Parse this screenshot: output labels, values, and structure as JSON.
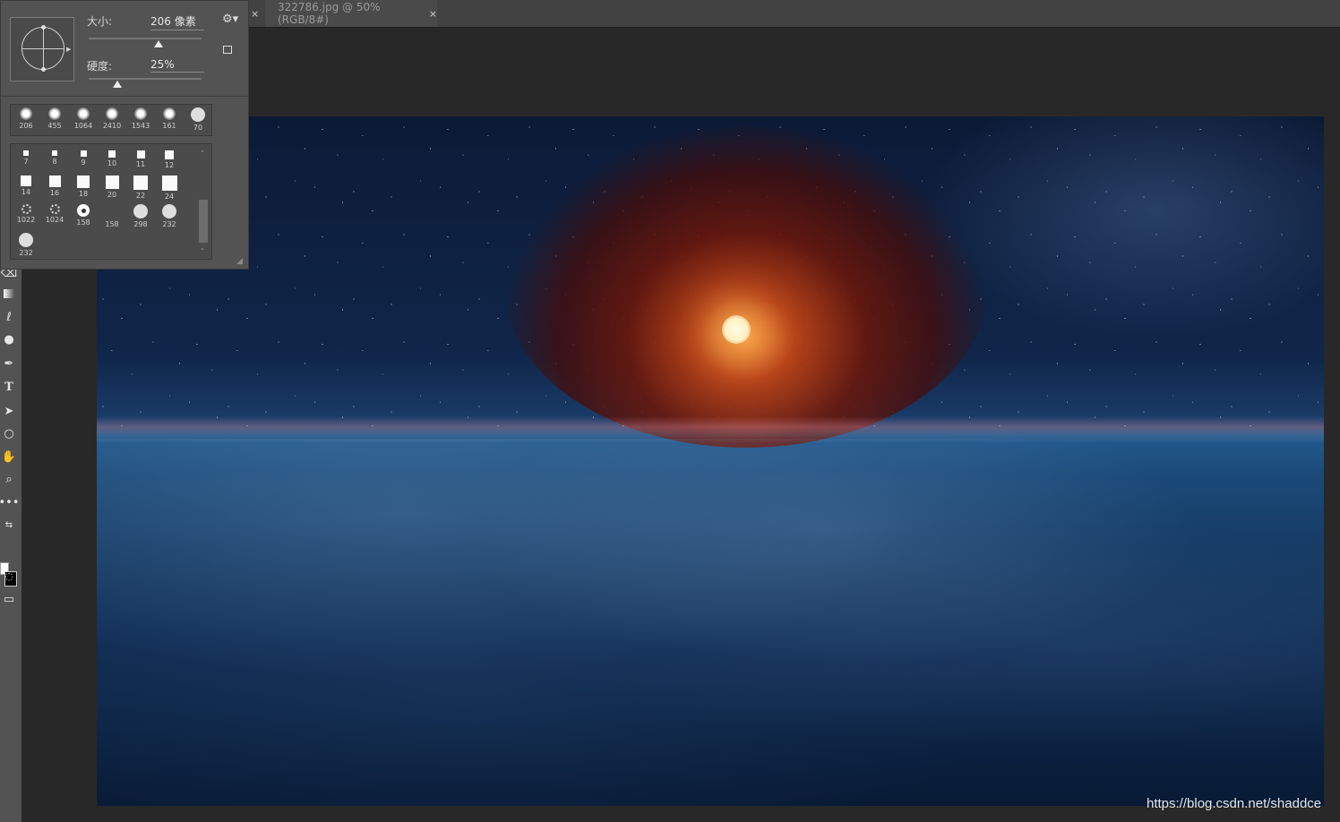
{
  "tabs": [
    {
      "label": "",
      "close": "×"
    },
    {
      "label": "322786.jpg @ 50%(RGB/8#)",
      "close": "×"
    }
  ],
  "brush_panel": {
    "size_label": "大小:",
    "size_value": "206 像素",
    "size_level": 0.62,
    "hardness_label": "硬度:",
    "hardness_value": "25%",
    "hardness_level": 0.25,
    "recent_brushes": [
      "206",
      "455",
      "1064",
      "2410",
      "1543",
      "161",
      "70"
    ],
    "brush_list": [
      [
        "7",
        "8",
        "9",
        "10",
        "11",
        "12"
      ],
      [
        "14",
        "16",
        "18",
        "20",
        "22",
        "24"
      ],
      [
        "1022",
        "1024",
        "158",
        "158",
        "298",
        "232"
      ],
      [
        "232"
      ]
    ]
  },
  "colors": {
    "foreground": "#ffffff",
    "background": "#000000"
  },
  "watermark": "https://blog.csdn.net/shaddce"
}
